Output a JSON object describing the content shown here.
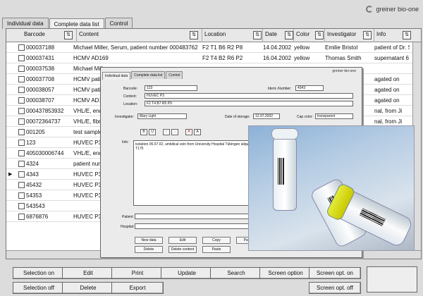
{
  "logo": {
    "text": "greiner bio-one"
  },
  "tabs": [
    "Individual data",
    "Complete data list",
    "Control"
  ],
  "columns": [
    "Barcode",
    "Content",
    "Location",
    "Date",
    "Color",
    "Investigator",
    "Info"
  ],
  "rows": [
    {
      "barcode": "000037188",
      "content": "Michael Miller, Serum, patient number 000483762",
      "location": "F2 T1 B6 R2 P8",
      "date": "14.04.2002",
      "color": "yellow",
      "investigator": "Emilie Bristol",
      "info": "patient of Dr. Sc"
    },
    {
      "barcode": "000037431",
      "content": "HCMV AD169",
      "location": "F2 T4 B2 R6 P2",
      "date": "16.04.2002",
      "color": "yellow",
      "investigator": "Thomas Smith",
      "info": "supernatant 6 d"
    },
    {
      "barcode": "000037538",
      "content": "Michael Mille",
      "location": "",
      "date": "",
      "color": "",
      "investigator": "",
      "info": ""
    },
    {
      "barcode": "000037708",
      "content": "HCMV patie",
      "location": "",
      "date": "",
      "color": "",
      "investigator": "",
      "info": "agated on"
    },
    {
      "barcode": "000038057",
      "content": "HCMV patie",
      "location": "",
      "date": "",
      "color": "",
      "investigator": "",
      "info": "agated on"
    },
    {
      "barcode": "000038707",
      "content": "HCMV AD16",
      "location": "",
      "date": "",
      "color": "",
      "investigator": "",
      "info": "agated on"
    },
    {
      "barcode": "000437853932",
      "content": "VHL/E, enda",
      "location": "",
      "date": "",
      "color": "",
      "investigator": "",
      "info": "nal, from Ji"
    },
    {
      "barcode": "00072364737",
      "content": "VHL/E, fibrob",
      "location": "",
      "date": "",
      "color": "",
      "investigator": "",
      "info": "nal, from Ji"
    },
    {
      "barcode": "001205",
      "content": "test sample",
      "location": "",
      "date": "",
      "color": "",
      "investigator": "",
      "info": ""
    },
    {
      "barcode": "123",
      "content": "HUVEC P3",
      "location": "",
      "date": "",
      "color": "",
      "investigator": "",
      "info": ""
    },
    {
      "barcode": "405030006744",
      "content": "VHL/E, enda",
      "location": "",
      "date": "",
      "color": "",
      "investigator": "",
      "info": ""
    },
    {
      "barcode": "4324",
      "content": "patient num",
      "location": "",
      "date": "",
      "color": "",
      "investigator": "",
      "info": ""
    },
    {
      "barcode": "4343",
      "content": "HUVEC P3",
      "location": "",
      "date": "",
      "color": "",
      "investigator": "",
      "info": ""
    },
    {
      "barcode": "45432",
      "content": "HUVEC P3",
      "location": "",
      "date": "",
      "color": "",
      "investigator": "",
      "info": ""
    },
    {
      "barcode": "54353",
      "content": "HUVEC P3",
      "location": "",
      "date": "",
      "color": "",
      "investigator": "",
      "info": ""
    },
    {
      "barcode": "543543",
      "content": "",
      "location": "",
      "date": "",
      "color": "",
      "investigator": "",
      "info": ""
    },
    {
      "barcode": "6876876",
      "content": "HUVEC P3",
      "location": "",
      "date": "",
      "color": "",
      "investigator": "",
      "info": ""
    }
  ],
  "right_edge": [
    "07.",
    "07.",
    "07.",
    "07.",
    "m Ji",
    "07.",
    "07.",
    "07."
  ],
  "dialog": {
    "tabs": [
      "Individual data",
      "Complete data list",
      "Control"
    ],
    "logo": "greiner bio-one",
    "barcode_label": "Barcode:",
    "barcode_value": "123",
    "ident_label": "Ident.-Number:",
    "ident_value": "4343",
    "content_label": "Content:",
    "content_value": "HUVEC P3",
    "location_label": "Location:",
    "location_value": "F2 T4 B7 R5 P9",
    "investigator_label": "Investigator:",
    "investigator_value": "Mary Light",
    "date_label": "Date of storage:",
    "date_value": "12.07.2002",
    "cap_label": "Cap color:",
    "cap_value": "transparent",
    "info_label": "Info:",
    "info_text": "isolation 05.07.02, umbilical vein from University Hospital Tübingen aliquot of V6 for a T175",
    "patient_label": "Patient:",
    "hospital_label": "Hospital:",
    "buttons": [
      "New data",
      "Edit",
      "Copy",
      "Paste re",
      "Delete",
      "Delete content",
      "Paste"
    ]
  },
  "bottom_buttons": [
    "Selection on",
    "Edit",
    "Print",
    "Update",
    "Search",
    "Screen option",
    "Screen opt. on",
    "Selection off",
    "Delete",
    "Export",
    "Screen opt. off"
  ]
}
